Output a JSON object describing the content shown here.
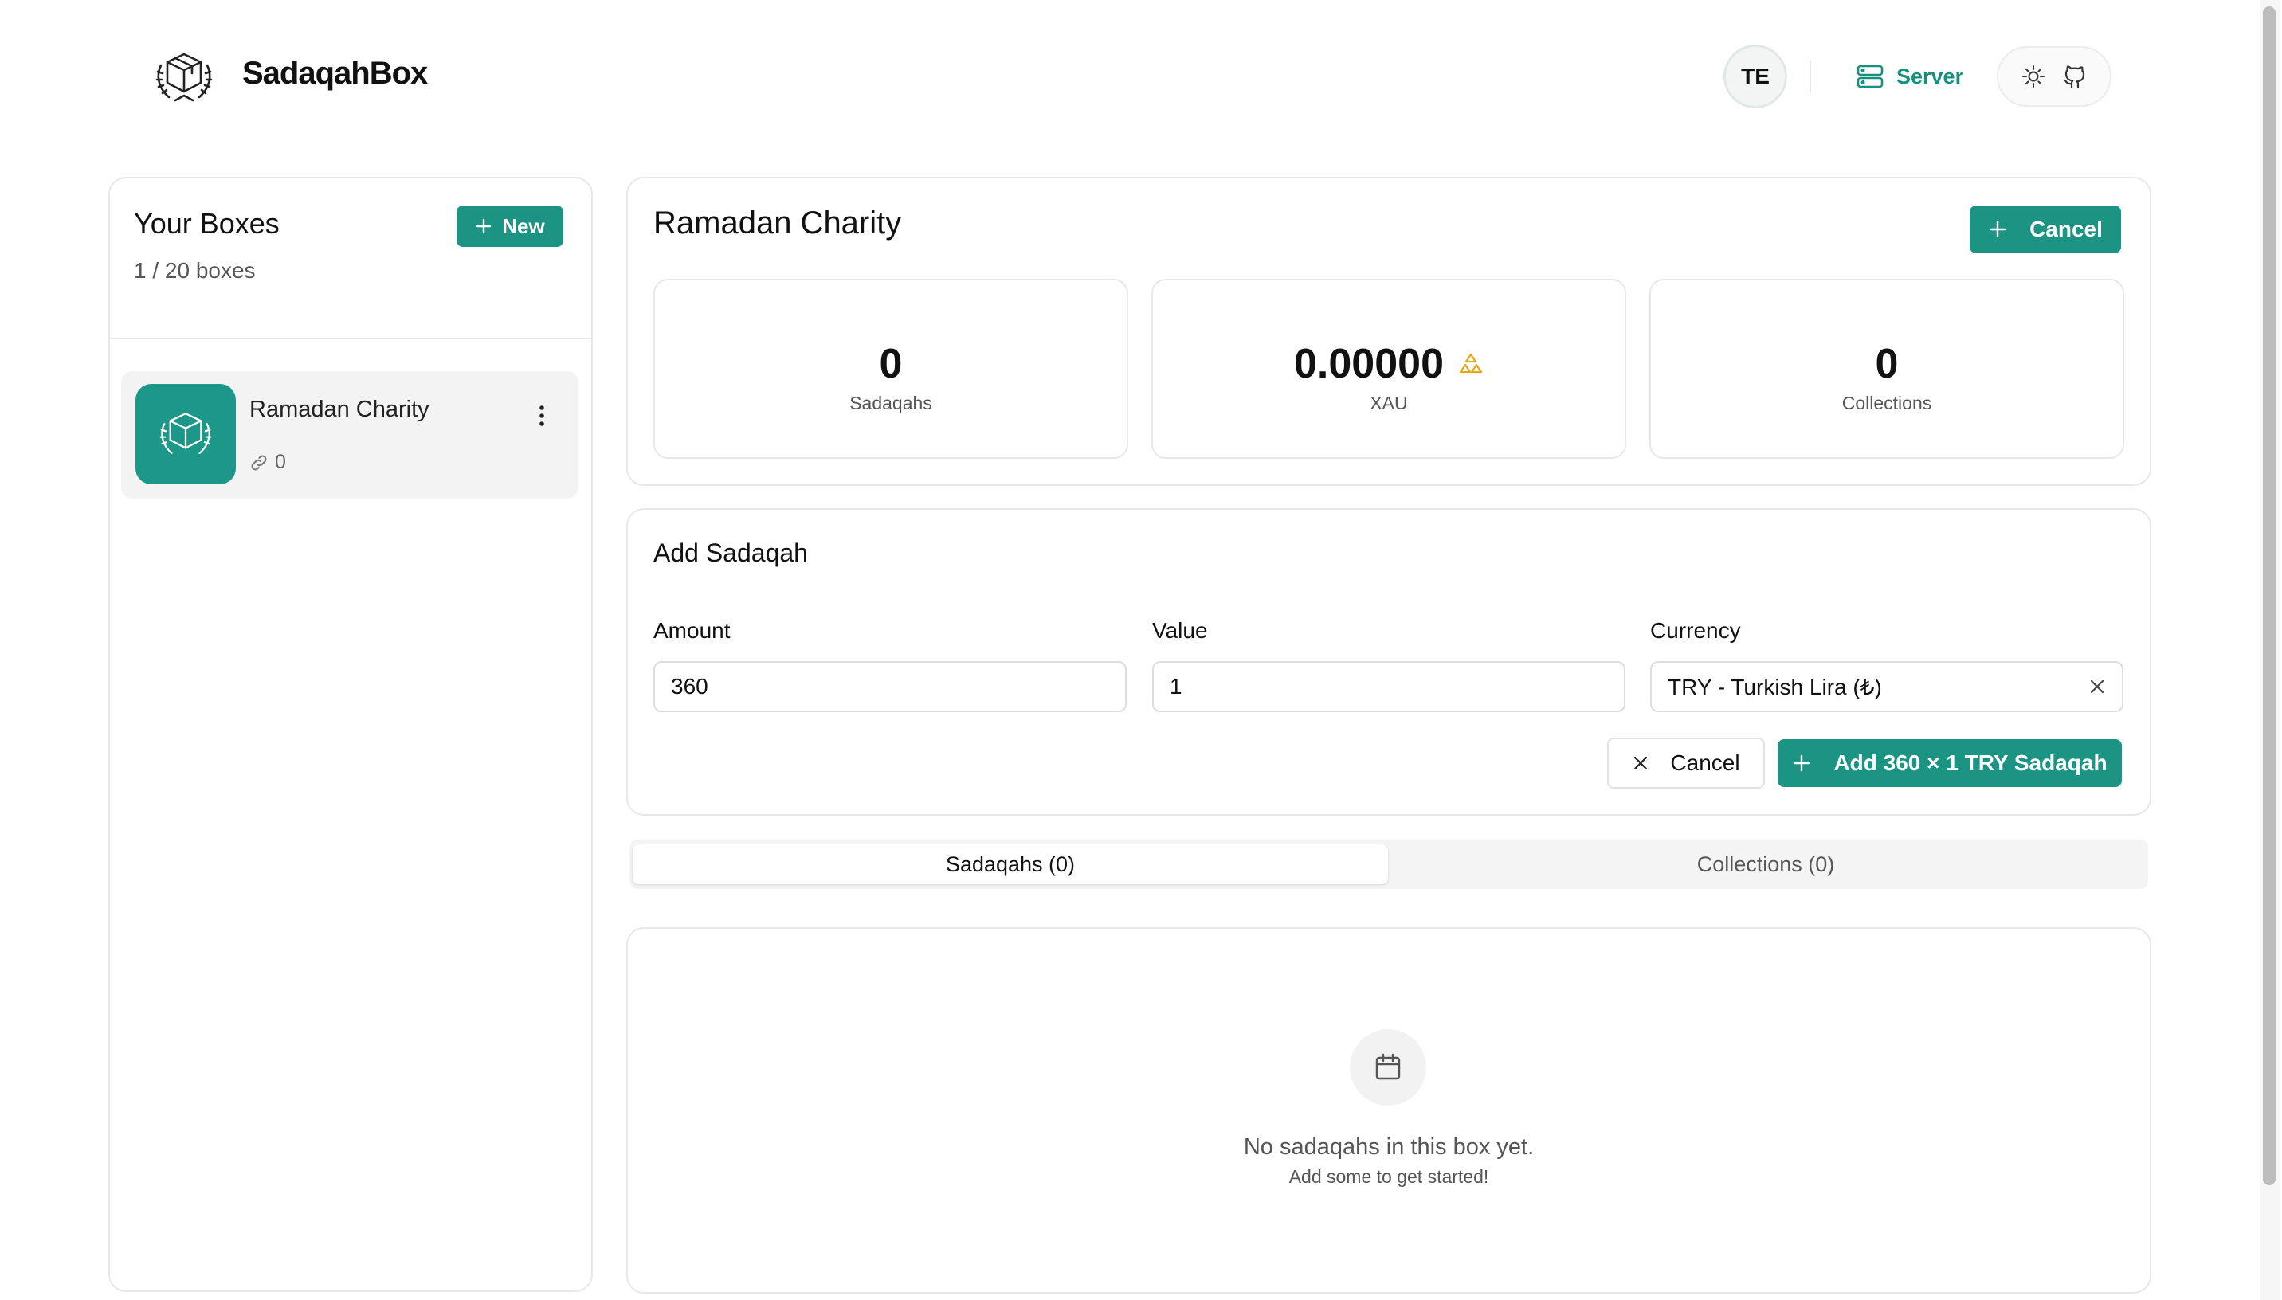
{
  "header": {
    "brand": "SadaqahBox",
    "avatar_initials": "TE",
    "server_label": "Server",
    "accent_color": "#1b9483"
  },
  "sidebar": {
    "title": "Your Boxes",
    "count_text": "1 / 20 boxes",
    "new_label": "New",
    "boxes": [
      {
        "name": "Ramadan Charity",
        "collections_count": "0"
      }
    ]
  },
  "box": {
    "title": "Ramadan Charity",
    "toggle_label": "Cancel",
    "stats": [
      {
        "value": "0",
        "label": "Sadaqahs"
      },
      {
        "value": "0.00000",
        "label": "XAU"
      },
      {
        "value": "0",
        "label": "Collections"
      }
    ]
  },
  "add_form": {
    "title": "Add Sadaqah",
    "amount_label": "Amount",
    "amount_value": "360",
    "value_label": "Value",
    "value_value": "1",
    "currency_label": "Currency",
    "currency_value": "TRY - Turkish Lira (₺)",
    "cancel_label": "Cancel",
    "submit_label": "Add 360 × 1 TRY Sadaqah"
  },
  "tabs": [
    {
      "label": "Sadaqahs (0)",
      "active": true
    },
    {
      "label": "Collections (0)",
      "active": false
    }
  ],
  "empty_state": {
    "message": "No sadaqahs in this box yet.",
    "hint": "Add some to get started!"
  }
}
